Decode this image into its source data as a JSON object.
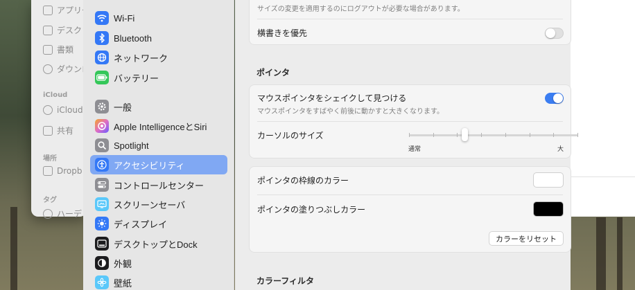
{
  "finder": {
    "items": [
      {
        "label": "アプリケ",
        "icon": "app-icon"
      },
      {
        "label": "デスクト",
        "icon": "desktop-icon"
      },
      {
        "label": "書類",
        "icon": "document-icon"
      },
      {
        "label": "ダウンロ",
        "icon": "download-icon"
      }
    ],
    "icloud_header": "iCloud",
    "icloud_items": [
      {
        "label": "iCloud",
        "icon": "cloud-icon"
      },
      {
        "label": "共有",
        "icon": "shared-folder-icon"
      }
    ],
    "places_header": "場所",
    "places_items": [
      {
        "label": "Dropb",
        "icon": "dropbox-icon"
      }
    ],
    "tags_header": "タグ",
    "tags_items": [
      {
        "label": "ハーデ",
        "icon": "tag-icon"
      }
    ]
  },
  "sidebar": {
    "items": [
      {
        "label": "Wi-Fi",
        "icon": "wifi-icon",
        "color": "#3478f6"
      },
      {
        "label": "Bluetooth",
        "icon": "bluetooth-icon",
        "color": "#3478f6"
      },
      {
        "label": "ネットワーク",
        "icon": "globe-icon",
        "color": "#3478f6"
      },
      {
        "label": "バッテリー",
        "icon": "battery-icon",
        "color": "#34c759"
      },
      {
        "label": "一般",
        "icon": "gear-icon",
        "color": "#8e8e93"
      },
      {
        "label": "Apple IntelligenceとSiri",
        "icon": "siri-icon",
        "color": "#e06dc5"
      },
      {
        "label": "Spotlight",
        "icon": "magnifier-icon",
        "color": "#8e8e93"
      },
      {
        "label": "アクセシビリティ",
        "icon": "accessibility-icon",
        "color": "#3478f6",
        "selected": true
      },
      {
        "label": "コントロールセンター",
        "icon": "control-center-icon",
        "color": "#8e8e93"
      },
      {
        "label": "スクリーンセーバ",
        "icon": "screensaver-icon",
        "color": "#5ac8fa"
      },
      {
        "label": "ディスプレイ",
        "icon": "sun-icon",
        "color": "#3478f6"
      },
      {
        "label": "デスクトップとDock",
        "icon": "dock-icon",
        "color": "#1c1c1e"
      },
      {
        "label": "外観",
        "icon": "appearance-icon",
        "color": "#1c1c1e"
      },
      {
        "label": "壁紙",
        "icon": "wallpaper-icon",
        "color": "#5ac8fa"
      }
    ]
  },
  "main": {
    "top_note": "サイズの変更を適用するのにログアウトが必要な場合があります。",
    "prefer_horizontal": {
      "label": "横書きを優先",
      "on": false
    },
    "pointer_section": "ポインタ",
    "shake": {
      "label": "マウスポインタをシェイクして見つける",
      "description": "マウスポインタをすばやく前後に動かすと大きくなります。",
      "on": true
    },
    "cursor_size": {
      "label": "カーソルのサイズ",
      "min_label": "通常",
      "max_label": "大",
      "value": 0.33
    },
    "outline_color": {
      "label": "ポインタの枠線のカラー",
      "color": "#ffffff"
    },
    "fill_color": {
      "label": "ポインタの塗りつぶしカラー",
      "color": "#000000"
    },
    "reset_button": "カラーをリセット",
    "color_filter_section": "カラーフィルタ",
    "accent": "#3b7df1"
  }
}
